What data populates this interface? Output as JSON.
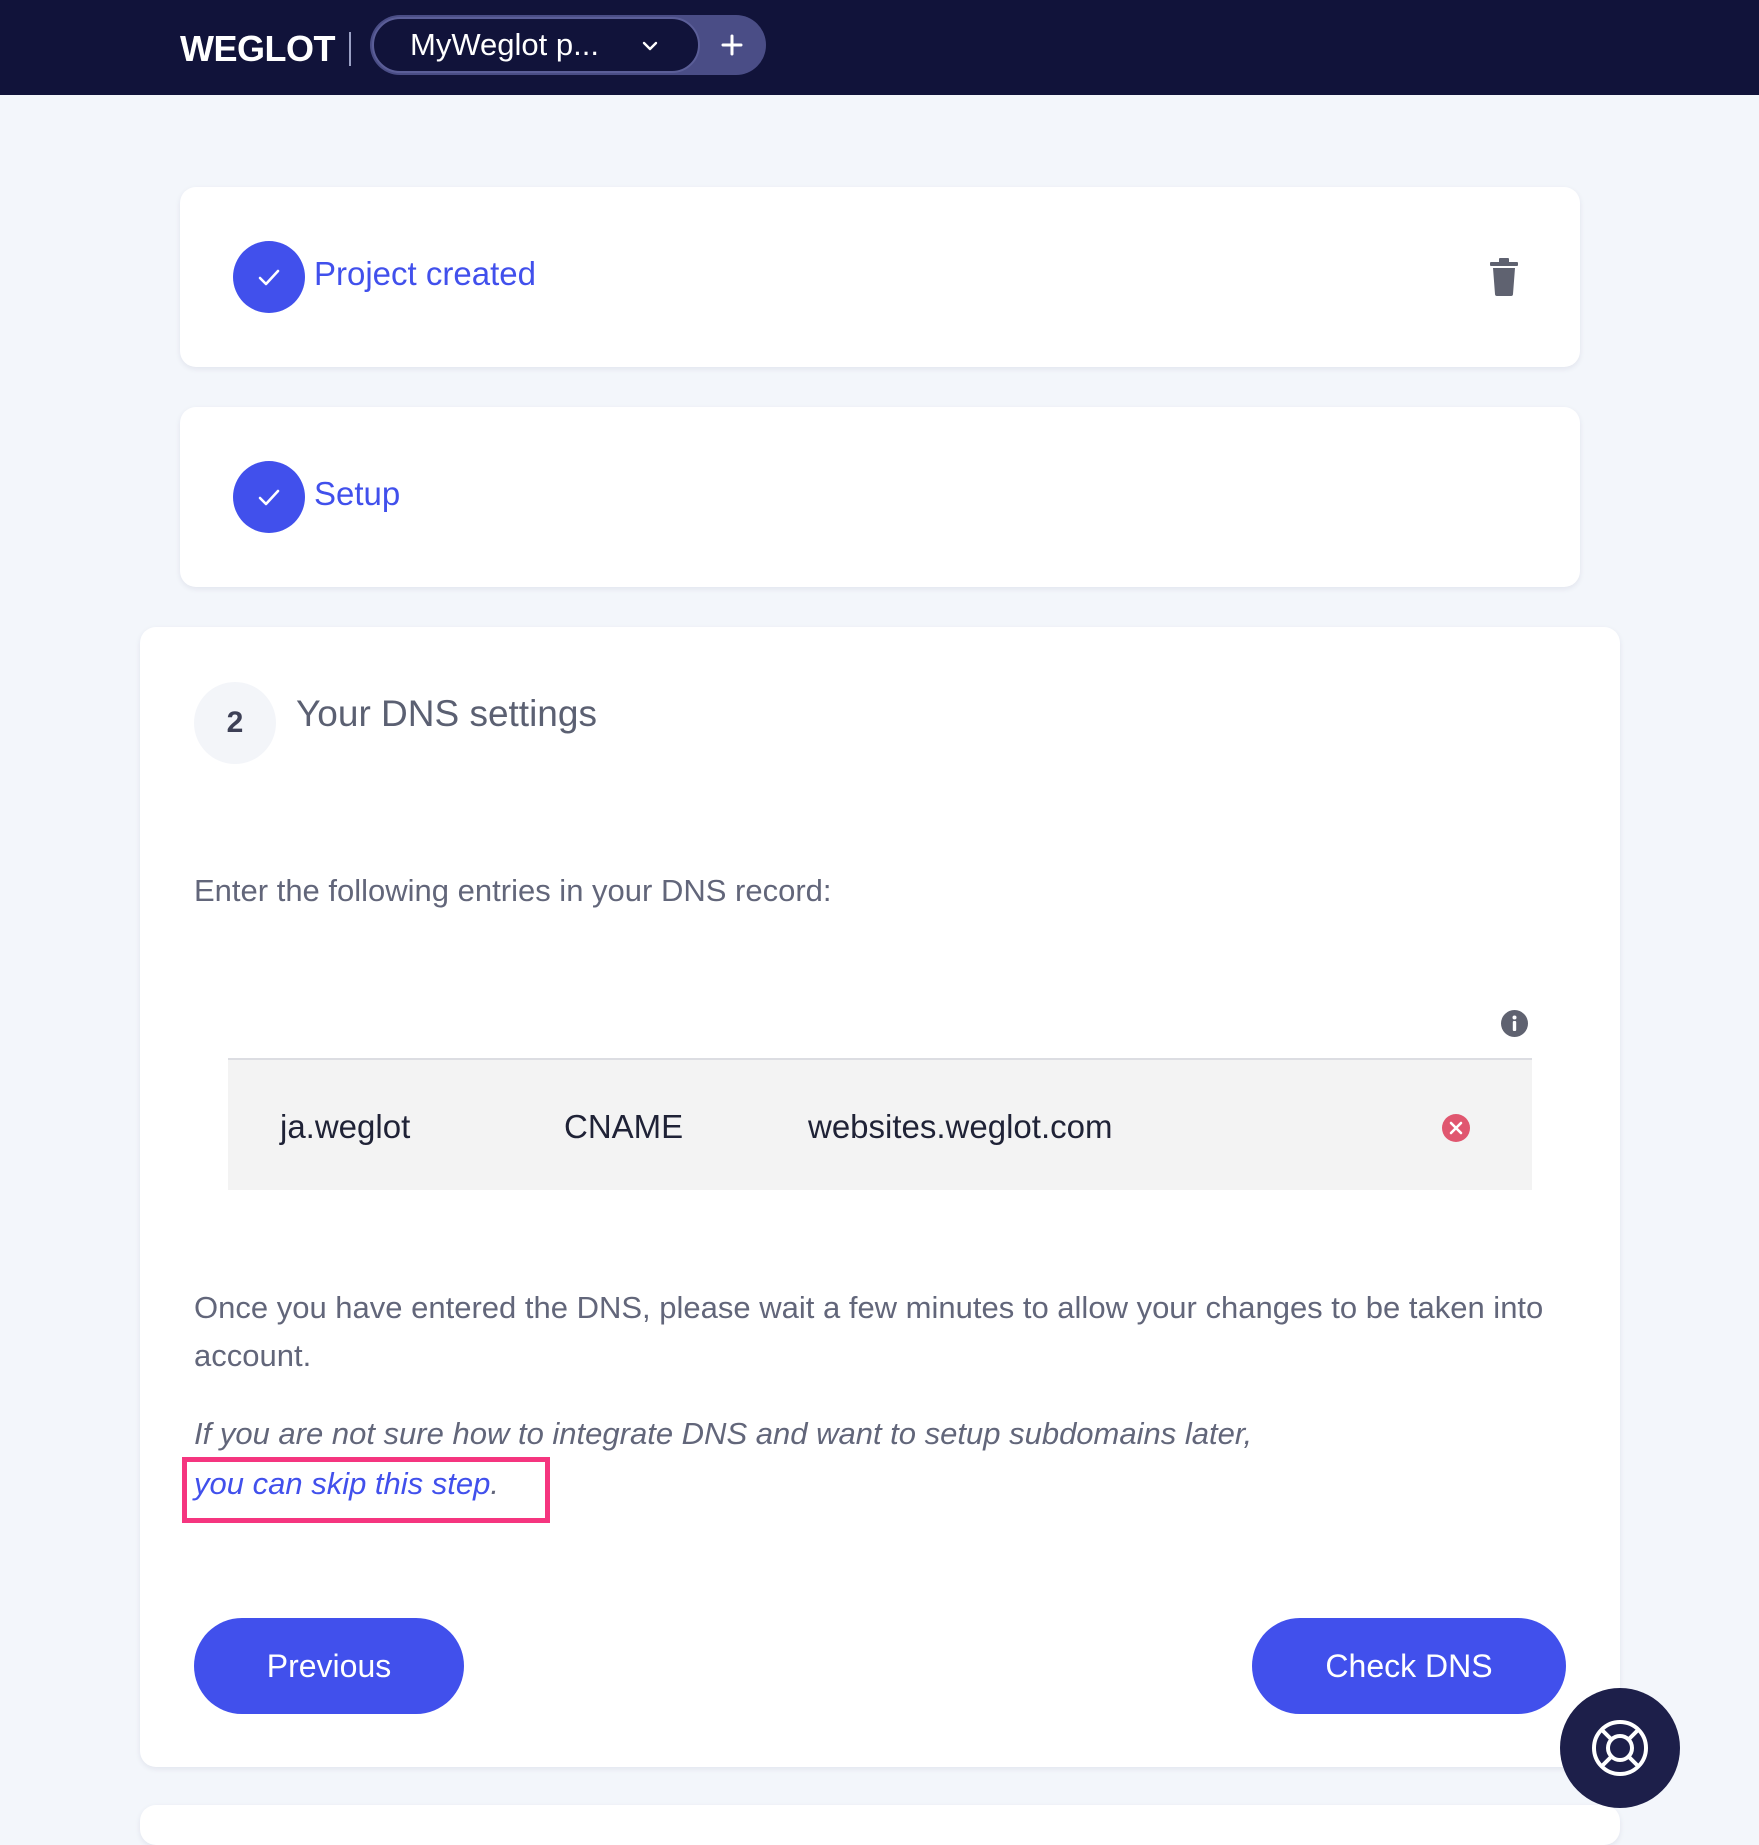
{
  "header": {
    "logo_text": "WEGLOT",
    "project_name": "MyWeglot p...",
    "add_project_icon": "plus-icon",
    "dropdown_icon": "chevron-down-icon"
  },
  "steps": {
    "project_created": {
      "label": "Project created",
      "icon": "check-icon"
    },
    "setup": {
      "label": "Setup",
      "icon": "check-icon"
    }
  },
  "dns": {
    "step_number": "2",
    "title": "Your DNS settings",
    "instruction": "Enter the following entries in your DNS record:",
    "records": [
      {
        "host": "ja.weglot",
        "type": "CNAME",
        "value": "websites.weglot.com"
      }
    ],
    "wait_note": "Once you have entered the DNS, please wait a few minutes to allow your changes to be taken into account.",
    "skip_note_prefix": "If you are not sure how to integrate DNS and want to setup subdomains later,",
    "skip_link": "you can skip this step",
    "skip_suffix": "."
  },
  "buttons": {
    "previous": "Previous",
    "check_dns": "Check DNS"
  },
  "colors": {
    "topbar": "#11133a",
    "accent": "#4150ec",
    "highlight": "#f5357f",
    "remove": "#e0566f"
  }
}
